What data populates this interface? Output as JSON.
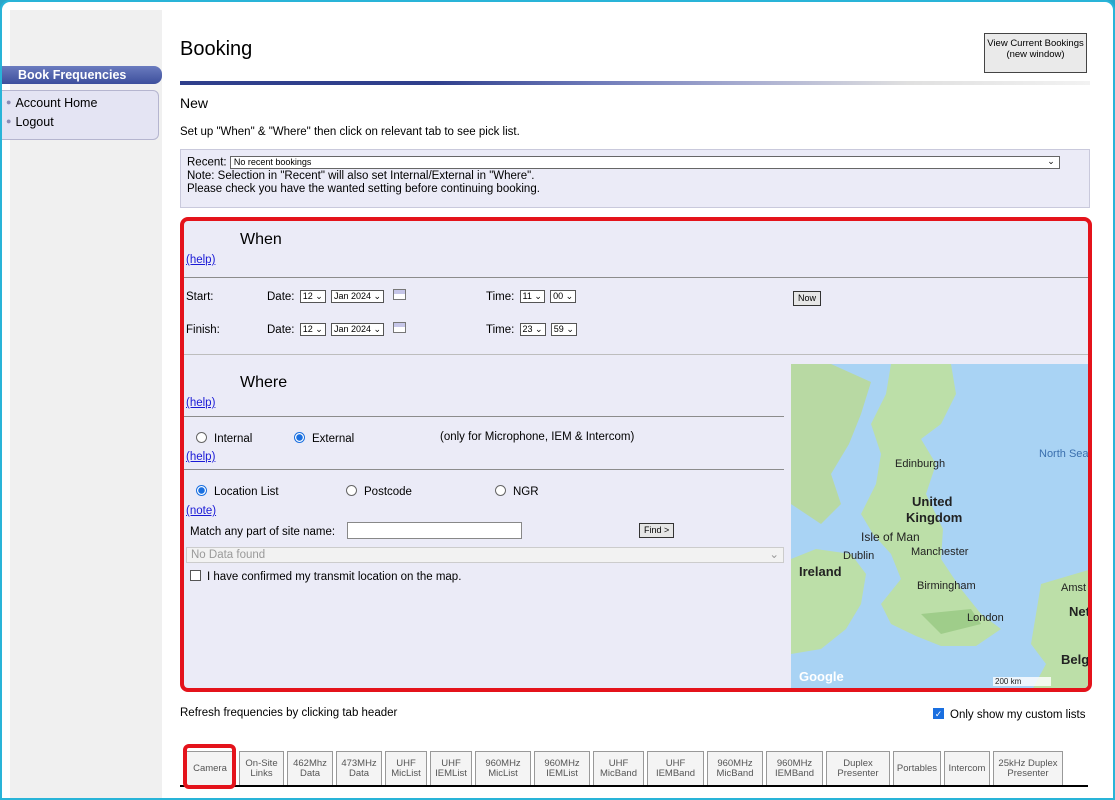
{
  "sidebar": {
    "heading": "Book Frequencies",
    "links": [
      {
        "label": "Account Home"
      },
      {
        "label": "Logout"
      }
    ]
  },
  "header": {
    "title": "Booking",
    "view_bookings_button": "View Current Bookings (new window)",
    "subtitle": "New",
    "intro": "Set up \"When\" & \"Where\" then click on relevant tab to see pick list."
  },
  "recent": {
    "label": "Recent:",
    "value": "No recent bookings",
    "note1": "Note: Selection in \"Recent\" will also set Internal/External in \"Where\".",
    "note2": "Please check you have the wanted setting before continuing booking."
  },
  "when": {
    "title": "When",
    "help": "(help)",
    "start_label": "Start:",
    "finish_label": "Finish:",
    "date_label": "Date:",
    "time_label": "Time:",
    "start": {
      "day": "12",
      "month": "Jan 2024",
      "hour": "11",
      "minute": "00"
    },
    "finish": {
      "day": "12",
      "month": "Jan 2024",
      "hour": "23",
      "minute": "59"
    },
    "now_button": "Now"
  },
  "where": {
    "title": "Where",
    "help": "(help)",
    "help2": "(help)",
    "note": "(note)",
    "internal": "Internal",
    "external": "External",
    "scope_note": "(only for Microphone, IEM & Intercom)",
    "selected_scope": "External",
    "location_list": "Location List",
    "postcode": "Postcode",
    "ngr": "NGR",
    "selected_mode": "Location List",
    "match_label": "Match any part of site name:",
    "match_value": "",
    "find_button": "Find >",
    "site_select": "No Data found",
    "confirm_label": "I have confirmed my transmit location on the map.",
    "confirm_checked": false
  },
  "map": {
    "labels": [
      "North Sea",
      "Edinburgh",
      "United",
      "Kingdom",
      "Isle of Man",
      "Manchester",
      "Dublin",
      "Ireland",
      "Birmingham",
      "London",
      "Amst",
      "Net",
      "Belg"
    ],
    "attribution": "Google",
    "scale": "200 km"
  },
  "footer": {
    "refresh": "Refresh frequencies by clicking tab header",
    "custom_label": "Only show my custom lists",
    "custom_checked": true
  },
  "tabs": [
    "Camera",
    "On-Site Links",
    "462Mhz Data",
    "473MHz Data",
    "UHF MicList",
    "UHF IEMList",
    "960MHz MicList",
    "960MHz IEMList",
    "UHF MicBand",
    "UHF IEMBand",
    "960MHz MicBand",
    "960MHz IEMBand",
    "Duplex Presenter",
    "Portables",
    "Intercom",
    "25kHz Duplex Presenter"
  ],
  "colors": {
    "accent": "#2f3f8c",
    "highlight": "#e4131b",
    "panel": "#ebebf7",
    "link": "#1a1ad6"
  }
}
